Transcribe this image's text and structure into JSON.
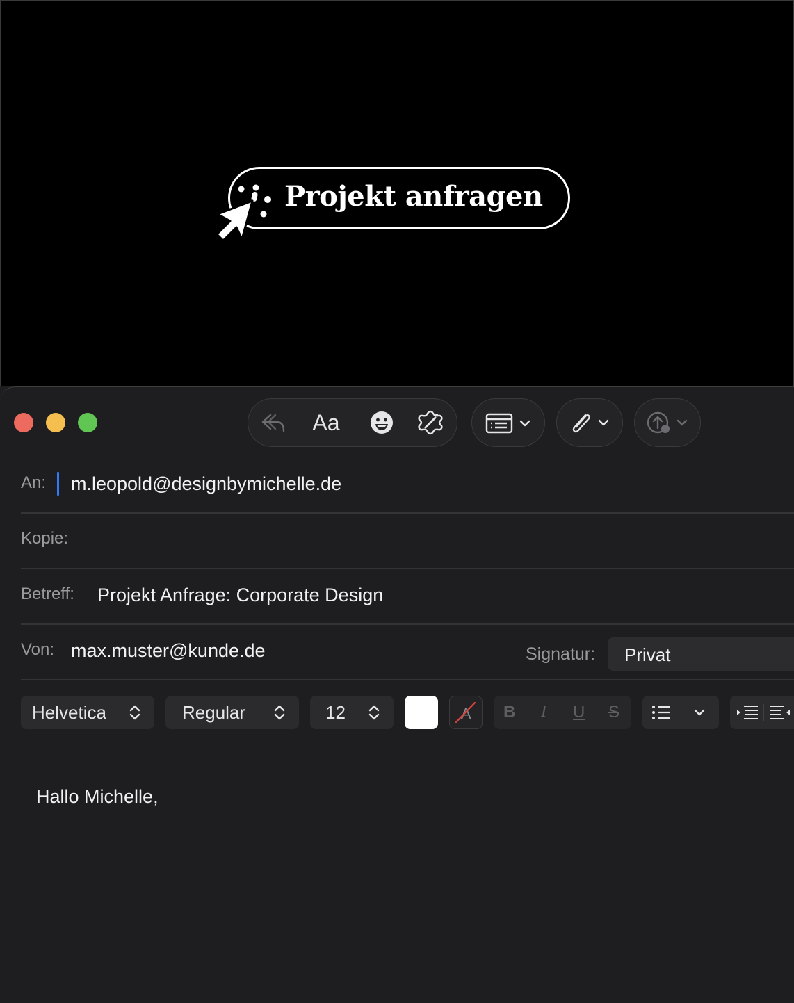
{
  "banner": {
    "cta_label": "Projekt anfragen",
    "icon": "cursor-click-icon",
    "background": "#000000",
    "foreground": "#ffffff"
  },
  "window": {
    "controls": [
      "close-icon",
      "minimize-icon",
      "maximize-icon"
    ],
    "colors": {
      "close": "#ed6a5e",
      "minimize": "#f5bf4f",
      "maximize": "#61c554"
    }
  },
  "toolbar": {
    "reply_icon": "reply-icon",
    "format_label": "Aa",
    "emoji_icon": "emoji-icon",
    "ai_icon": "writing-tools-icon",
    "header_fields_icon": "header-fields-icon",
    "attach_icon": "paperclip-icon",
    "send_later_icon": "send-later-icon"
  },
  "fields": {
    "to": {
      "label": "An:",
      "value": "m.leopold@designbymichelle.de"
    },
    "cc": {
      "label": "Kopie:",
      "value": ""
    },
    "subject": {
      "label": "Betreff:",
      "value": "Projekt Anfrage: Corporate Design"
    },
    "from": {
      "label": "Von:",
      "value": "max.muster@kunde.de"
    },
    "signature": {
      "label": "Signatur:",
      "value": "Privat"
    }
  },
  "format_bar": {
    "font": "Helvetica",
    "style": "Regular",
    "size": "12",
    "text_color": "#ffffff",
    "bold": "B",
    "italic": "I",
    "underline": "U",
    "strike": "S"
  },
  "body": {
    "text": "Hallo Michelle,"
  }
}
